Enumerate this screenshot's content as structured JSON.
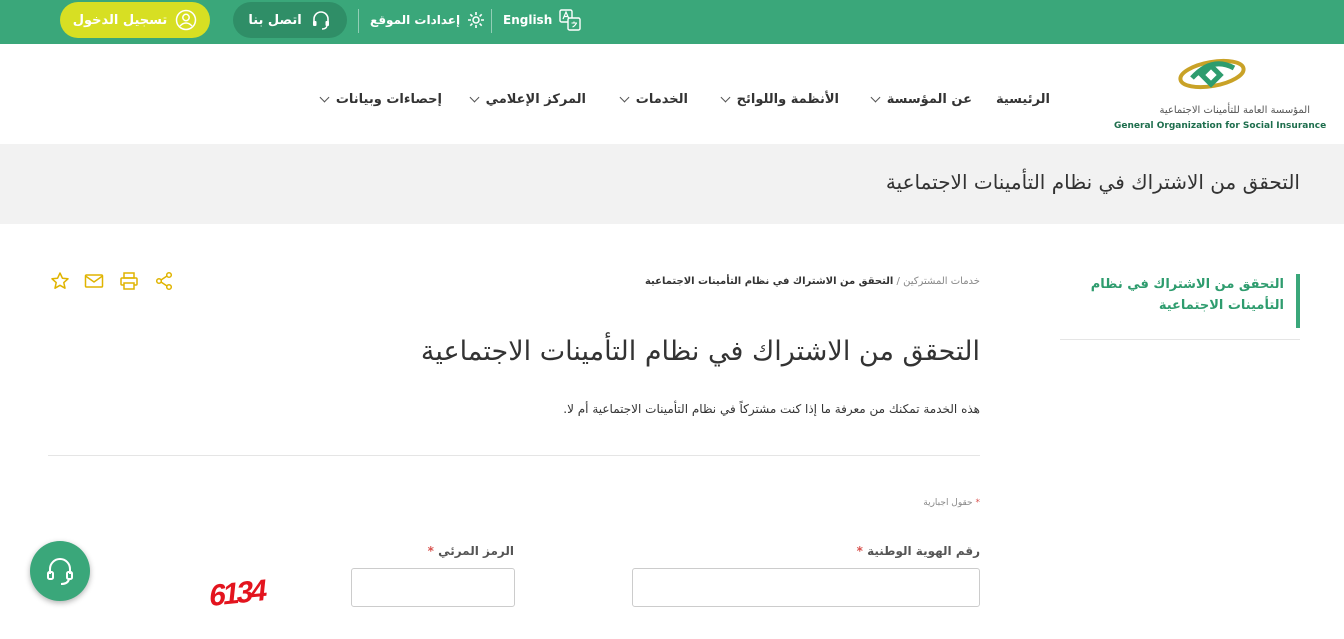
{
  "topbar": {
    "login_label": "تسجيل الدخول",
    "contact_label": "اتصل بنا",
    "settings_label": "إعدادات الموقع",
    "language_label": "English"
  },
  "header": {
    "logo_ar": "المؤسسة العامة للتأمينات الاجتماعية",
    "logo_en": "General Organization for Social Insurance",
    "nav": {
      "home": "الرئيسية",
      "about": "عن المؤسسة",
      "regulations": "الأنظمة واللوائح",
      "services": "الخدمات",
      "media": "المركز الإعلامي",
      "stats": "إحصاءات وبيانات"
    }
  },
  "banner": {
    "title": "التحقق من الاشتراك في نظام التأمينات الاجتماعية"
  },
  "sidebar": {
    "active_item": "التحقق من الاشتراك في نظام التأمينات الاجتماعية"
  },
  "breadcrumb": {
    "parent": "خدمات المشتركين",
    "separator": "/",
    "current": "التحقق من الاشتراك في نظام التأمينات الاجتماعية"
  },
  "main": {
    "title": "التحقق من الاشتراك في نظام التأمينات الاجتماعية",
    "description": "هذه الخدمة تمكنك من معرفة ما إذا كنت مشتركاً في نظام التأمينات الاجتماعية أم لا.",
    "required_note": "حقول اجبارية",
    "required_star": "*"
  },
  "form": {
    "national_id_label": "رقم الهوية الوطنية",
    "national_id_value": "",
    "captcha_label": "الرمز المرئي",
    "captcha_value": "",
    "captcha_image_text": "6134"
  },
  "icons": {
    "share": "share-icon",
    "print": "print-icon",
    "mail": "mail-icon",
    "favorite": "star-icon",
    "headset": "headset-icon"
  },
  "colors": {
    "primary_green": "#3aa77a",
    "dark_green": "#2f8e67",
    "login_yellow": "#d7df23",
    "icon_gold": "#e0b400",
    "captcha_red": "#e3141e"
  }
}
